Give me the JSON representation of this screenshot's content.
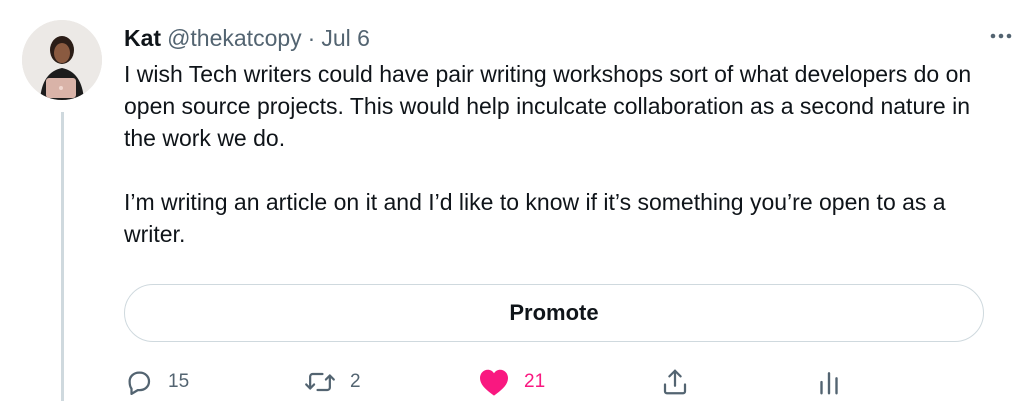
{
  "tweet": {
    "author_name": "Kat",
    "author_handle": "@thekatcopy",
    "separator": "·",
    "date": "Jul 6",
    "body_paragraphs": [
      "I wish Tech writers could have pair writing workshops sort of what developers do on open source projects. This would help inculcate collaboration as a second nature in the work we do.",
      "I’m writing an article on it and I’d like to know if it’s something you’re open to as a writer."
    ],
    "promote_label": "Promote",
    "actions": {
      "reply": {
        "icon": "reply-icon",
        "count": "15"
      },
      "retweet": {
        "icon": "retweet-icon",
        "count": "2"
      },
      "like": {
        "icon": "heart-icon",
        "count": "21",
        "liked": true
      },
      "share": {
        "icon": "share-icon"
      },
      "analytics": {
        "icon": "analytics-icon"
      }
    }
  },
  "colors": {
    "text": "#0f1419",
    "secondary": "#536471",
    "like": "#f91880",
    "border": "#cfd9de"
  }
}
